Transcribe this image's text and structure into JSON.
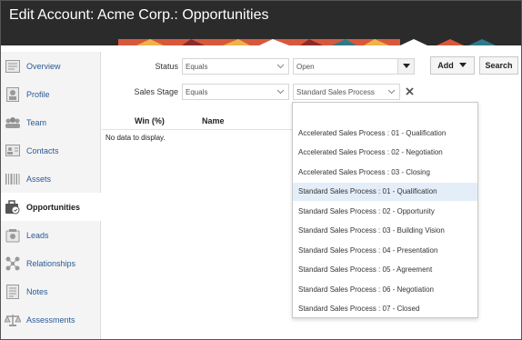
{
  "header": {
    "title": "Edit Account: Acme Corp.: Opportunities"
  },
  "sidebar": {
    "items": [
      {
        "label": "Overview",
        "icon": "overview-icon"
      },
      {
        "label": "Profile",
        "icon": "profile-icon"
      },
      {
        "label": "Team",
        "icon": "team-icon"
      },
      {
        "label": "Contacts",
        "icon": "contacts-icon"
      },
      {
        "label": "Assets",
        "icon": "assets-icon"
      },
      {
        "label": "Opportunities",
        "icon": "opportunities-icon",
        "active": true
      },
      {
        "label": "Leads",
        "icon": "leads-icon"
      },
      {
        "label": "Relationships",
        "icon": "relationships-icon"
      },
      {
        "label": "Notes",
        "icon": "notes-icon"
      },
      {
        "label": "Assessments",
        "icon": "assessments-icon"
      }
    ]
  },
  "filters": {
    "status": {
      "label": "Status",
      "operator": "Equals",
      "value": "Open"
    },
    "sales_stage": {
      "label": "Sales Stage",
      "operator": "Equals",
      "placeholder": "Standard Sales Process"
    }
  },
  "toolbar": {
    "add_label": "Add",
    "search_label": "Search"
  },
  "results": {
    "columns": [
      "Win (%)",
      "Name"
    ],
    "empty_text": "No data to display."
  },
  "dropdown": {
    "options": [
      "Accelerated Sales Process : 01 - Qualification",
      "Accelerated Sales Process : 02 - Negotiation",
      "Accelerated Sales Process : 03 - Closing",
      "Standard Sales Process : 01 - Qualification",
      "Standard Sales Process : 02 - Opportunity",
      "Standard Sales Process : 03 - Building Vision",
      "Standard Sales Process : 04 - Presentation",
      "Standard Sales Process : 05 - Agreement",
      "Standard Sales Process : 06 - Negotiation",
      "Standard Sales Process : 07 - Closed"
    ],
    "highlighted": "Standard Sales Process : 01 - Qualification"
  },
  "colors": {
    "header_bg": "#2b2b2b",
    "link": "#2a5a96",
    "highlight": "#e4eef9"
  }
}
